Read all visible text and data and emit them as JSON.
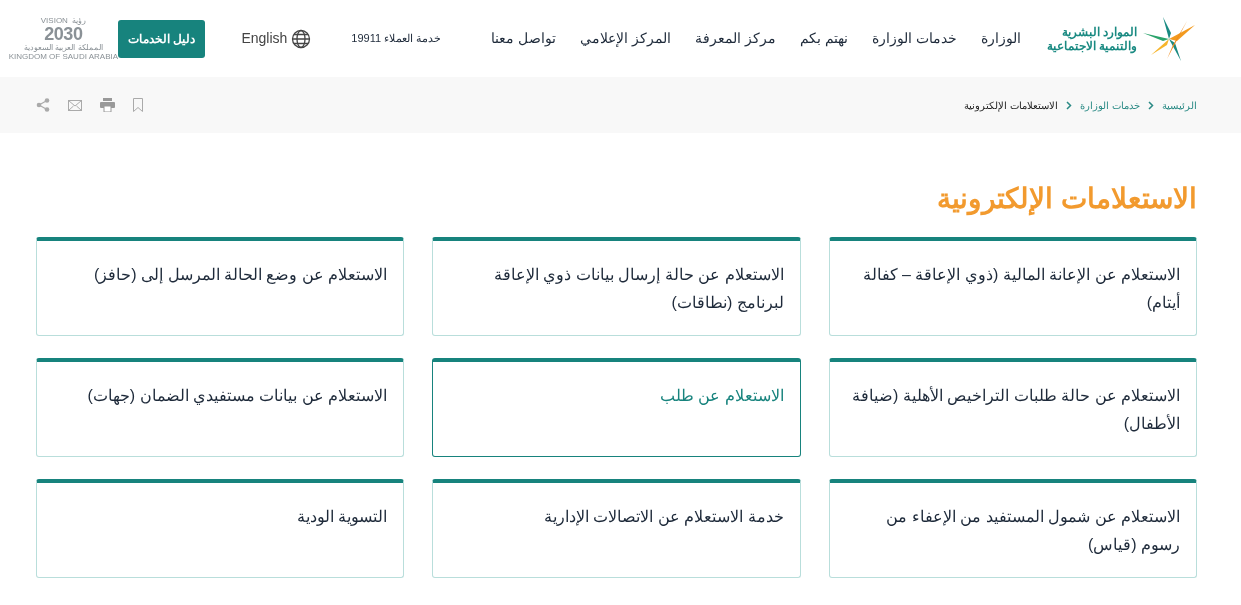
{
  "header": {
    "logo_lines": [
      "الموارد البشرية",
      "والتنمية الاجتماعية"
    ],
    "nav": [
      {
        "label": "الوزارة",
        "selected": false
      },
      {
        "label": "خدمات الوزارة",
        "selected": false
      },
      {
        "label": "نهتم بكم",
        "selected": false
      },
      {
        "label": "مركز المعرفة",
        "selected": false
      },
      {
        "label": "المركز الإعلامي",
        "selected": false
      },
      {
        "label": "تواصل معنا",
        "selected": false
      }
    ],
    "customer_service": "خدمة العملاء 19911",
    "language": "English",
    "services_button": "دليل الخدمات",
    "vision": {
      "word": "VISION",
      "arabic": "رؤية",
      "year": "2030",
      "country_ar": "المملكة العربية السعودية",
      "country_en": "KINGDOM OF SAUDI ARABIA"
    }
  },
  "breadcrumb": [
    "الرئيسية",
    "خدمات الوزارة",
    "الاستعلامات الإلكترونية"
  ],
  "title": "الاستعلامات الإلكترونية",
  "cards": [
    {
      "label": "الاستعلام عن الإعانة المالية (ذوي الإعاقة – كفالة أيتام)",
      "highlighted": false
    },
    {
      "label": "الاستعلام عن حالة إرسال بيانات ذوي الإعاقة لبرنامج (نطاقات)",
      "highlighted": false
    },
    {
      "label": "الاستعلام عن وضع الحالة المرسل إلى (حافز)",
      "highlighted": false
    },
    {
      "label": "الاستعلام عن حالة طلبات التراخيص الأهلية (ضيافة الأطفال)",
      "highlighted": false
    },
    {
      "label": "الاستعلام عن طلب",
      "highlighted": true
    },
    {
      "label": "الاستعلام عن بيانات مستفيدي الضمان (جهات)",
      "highlighted": false
    },
    {
      "label": "الاستعلام عن شمول المستفيد من الإعفاء من رسوم (قياس)",
      "highlighted": false
    },
    {
      "label": "خدمة الاستعلام عن الاتصالات الإدارية",
      "highlighted": false
    },
    {
      "label": "التسوية الودية",
      "highlighted": false
    }
  ]
}
